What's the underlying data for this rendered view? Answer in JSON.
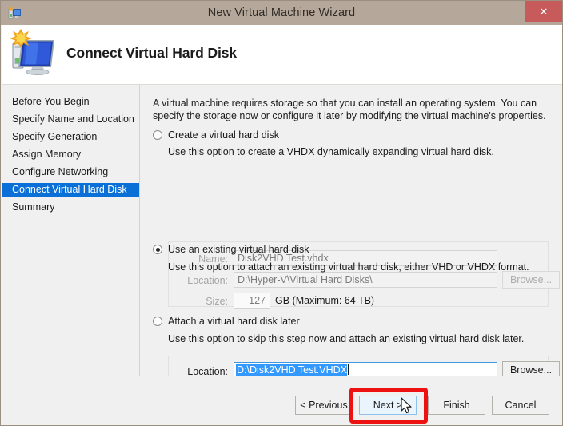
{
  "window": {
    "title": "New Virtual Machine Wizard",
    "titlebar_icon": "virtual-machine-icon",
    "close_label": "✕",
    "titlebar_color": "#b5a79a",
    "close_color": "#c75b5b"
  },
  "header": {
    "title": "Connect Virtual Hard Disk",
    "icon": "computer-monitor-icon"
  },
  "sidebar": {
    "selected_index": 5,
    "selection_color": "#0b6fd8",
    "items": [
      {
        "label": "Before You Begin"
      },
      {
        "label": "Specify Name and Location"
      },
      {
        "label": "Specify Generation"
      },
      {
        "label": "Assign Memory"
      },
      {
        "label": "Configure Networking"
      },
      {
        "label": "Connect Virtual Hard Disk"
      },
      {
        "label": "Summary"
      }
    ]
  },
  "content": {
    "intro_line1": "A virtual machine requires storage so that you can install an operating system. You can specify the",
    "intro_line2": "storage now or configure it later by modifying the virtual machine's properties.",
    "options": [
      {
        "id": "create",
        "label": "Create a virtual hard disk",
        "description": "Use this option to create a VHDX dynamically expanding virtual hard disk.",
        "selected": false,
        "enabled": false
      },
      {
        "id": "existing",
        "label": "Use an existing virtual hard disk",
        "description": "Use this option to attach an existing virtual hard disk, either VHD or VHDX format.",
        "selected": true,
        "enabled": true
      },
      {
        "id": "later",
        "label": "Attach a virtual hard disk later",
        "description": "Use this option to skip this step now and attach an existing virtual hard disk later.",
        "selected": false,
        "enabled": false
      }
    ],
    "create_group": {
      "name_label": "Name:",
      "name_value": "Disk2VHD Test.vhdx",
      "location_label": "Location:",
      "location_value": "D:\\Hyper-V\\Virtual Hard Disks\\",
      "browse_label": "Browse...",
      "size_label": "Size:",
      "size_value": "127",
      "size_units": "GB (Maximum: 64 TB)"
    },
    "existing_group": {
      "location_label": "Location:",
      "location_value": "D:\\Disk2VHD Test.VHDX",
      "location_selected": true,
      "browse_label": "Browse..."
    }
  },
  "footer": {
    "previous_label": "< Previous",
    "next_label": "Next >",
    "finish_label": "Finish",
    "cancel_label": "Cancel",
    "highlighted_button": "next-button",
    "highlight_color": "#ee1111"
  }
}
